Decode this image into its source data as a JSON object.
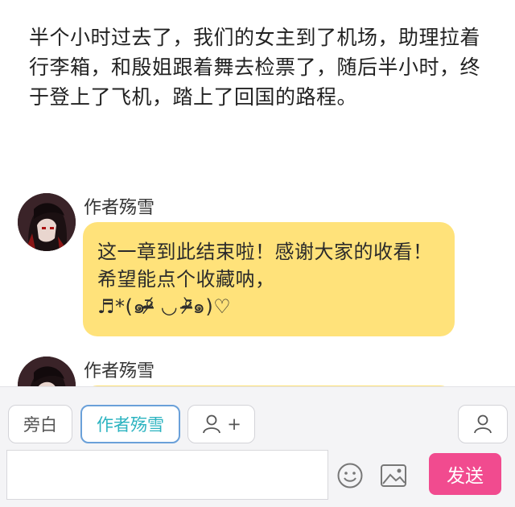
{
  "narration": {
    "text": "半个小时过去了，我们的女主到了机场，助理拉着行李箱，和殷姐跟着舞去检票了，随后半小时，终于登上了飞机，踏上了回国的路程。"
  },
  "messages": [
    {
      "author": "作者殇雪",
      "text": "这一章到此结束啦！感谢大家的收看！希望能点个收藏呐，",
      "emoticon": "♬*(๑ᵒ̴̶̷᷄ ◡ ᵒ̴̶̷᷅๑)♡"
    },
    {
      "author": "作者殇雪"
    }
  ],
  "bottom": {
    "chips": {
      "narration": "旁白",
      "author": "作者殇雪",
      "add_plus": "+"
    },
    "send_label": "发送",
    "colors": {
      "bubble": "#ffe27a",
      "send": "#f14b8f",
      "active_border": "#6aa0d9",
      "active_text": "#2bb3c0"
    },
    "icons": [
      "person-add-icon",
      "person-icon",
      "smiley-icon",
      "image-icon"
    ]
  }
}
